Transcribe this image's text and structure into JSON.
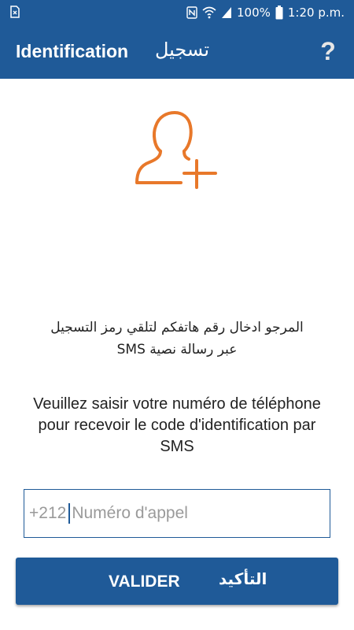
{
  "status_bar": {
    "battery": "100%",
    "time": "1:20 p.m.",
    "icons": [
      "sim-card-icon",
      "nfc-icon",
      "wifi-icon",
      "signal-icon",
      "battery-icon"
    ]
  },
  "app_bar": {
    "title": "Identification",
    "title_ar": "تسجيل",
    "help_icon": "?"
  },
  "main": {
    "icon": "add-user-icon",
    "icon_color": "#e8782a",
    "instructions_ar_line1": "المرجو ادخال رقم هاتفكم لتلقي رمز التسجيل",
    "instructions_ar_line2": "عبر رسالة نصية SMS",
    "instructions_fr": "Veuillez saisir votre numéro de téléphone pour recevoir le code d'identification par SMS"
  },
  "phone_input": {
    "prefix": "+212",
    "value": "",
    "placeholder": "Numéro d'appel"
  },
  "validate_button": {
    "label": "VALIDER",
    "label_ar": "التأكيد"
  },
  "colors": {
    "primary": "#1f5a98",
    "accent": "#e8782a"
  }
}
